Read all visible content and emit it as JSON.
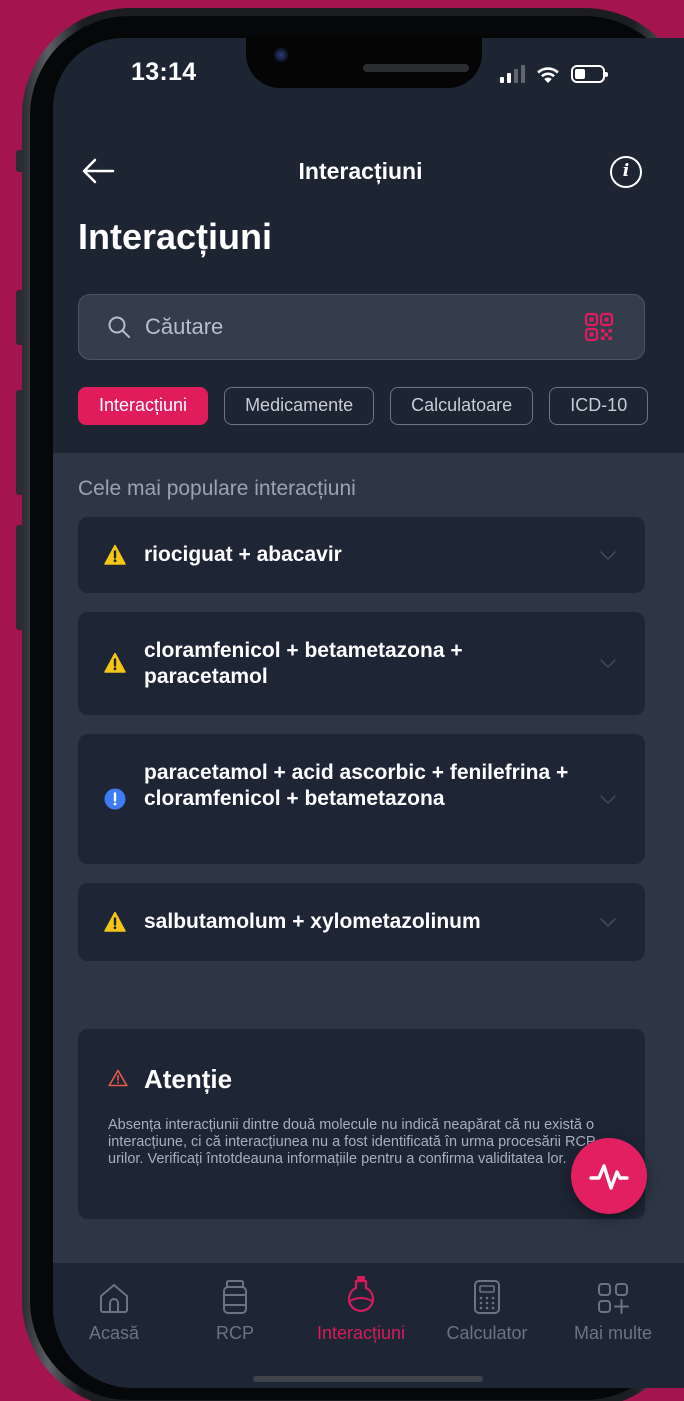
{
  "status": {
    "time": "13:14"
  },
  "header": {
    "title": "Interacțiuni"
  },
  "page": {
    "title": "Interacțiuni"
  },
  "search": {
    "placeholder": "Căutare"
  },
  "chips": [
    "Interacțiuni",
    "Medicamente",
    "Calculatoare",
    "ICD-10"
  ],
  "section": {
    "label": "Cele mai populare interacțiuni"
  },
  "cards": [
    {
      "text": "riociguat + abacavir",
      "severity": "warning"
    },
    {
      "text": "cloramfenicol + betametazona + paracetamol",
      "severity": "warning"
    },
    {
      "text": "paracetamol + acid ascorbic + fenilefrina + cloramfenicol + betametazona",
      "severity": "info"
    },
    {
      "text": "salbutamolum + xylometazolinum",
      "severity": "warning"
    }
  ],
  "notice": {
    "title": "Atenție",
    "body": "Absența interacțiunii dintre două molecule nu indică neapărat că nu există o interacțiune, ci că interacțiunea nu a fost identificată în urma procesării RCP-urilor. Verificați întotdeauna informațiile pentru a confirma validitatea lor."
  },
  "tabs": [
    {
      "label": "Acasă",
      "icon": "home-icon"
    },
    {
      "label": "RCP",
      "icon": "pill-bottle-icon"
    },
    {
      "label": "Interacțiuni",
      "icon": "flask-icon",
      "active": true
    },
    {
      "label": "Calculator",
      "icon": "calculator-icon"
    },
    {
      "label": "Mai multe",
      "icon": "grid-plus-icon"
    }
  ],
  "colors": {
    "accent": "#e01c5d",
    "warning": "#f5c518",
    "info": "#3d7cf5",
    "background": "#1d2432",
    "outer": "#a4144f"
  }
}
